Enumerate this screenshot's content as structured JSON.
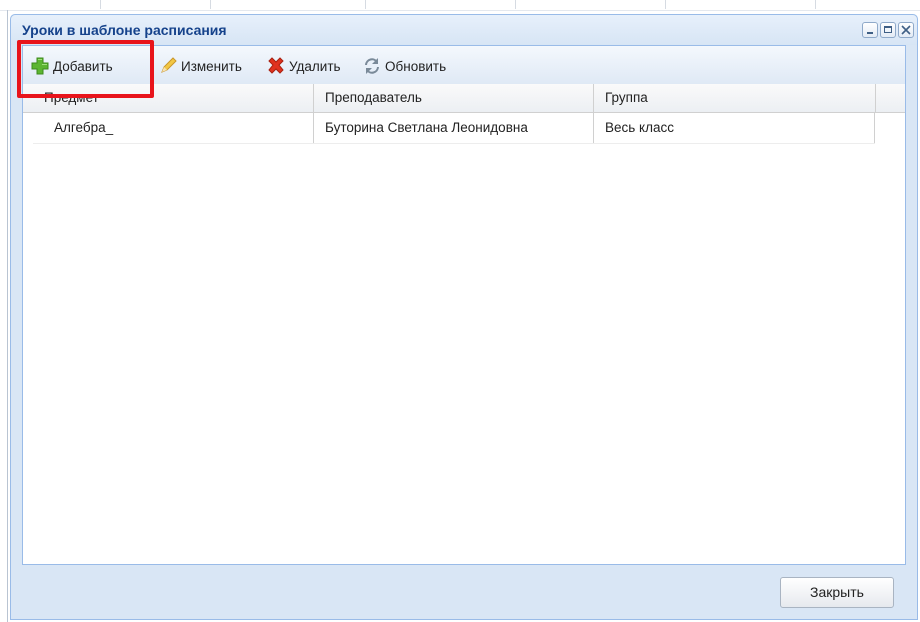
{
  "window": {
    "title": "Уроки в шаблоне расписания",
    "controls": [
      "minimize-icon",
      "maximize-icon",
      "close-icon"
    ]
  },
  "toolbar": {
    "add_label": "Добавить",
    "edit_label": "Изменить",
    "delete_label": "Удалить",
    "refresh_label": "Обновить",
    "highlight_color": "#e8141b"
  },
  "grid": {
    "columns": [
      "Предмет",
      "Преподаватель",
      "Группа"
    ],
    "rows": [
      [
        "Алгебра_",
        "Буторина Светлана Леонидовна",
        "Весь класс"
      ]
    ]
  },
  "footer": {
    "close_label": "Закрыть"
  },
  "colors": {
    "title_text": "#15428b",
    "panel_border": "#99bbe8",
    "window_bg": "#d9e6f5"
  }
}
